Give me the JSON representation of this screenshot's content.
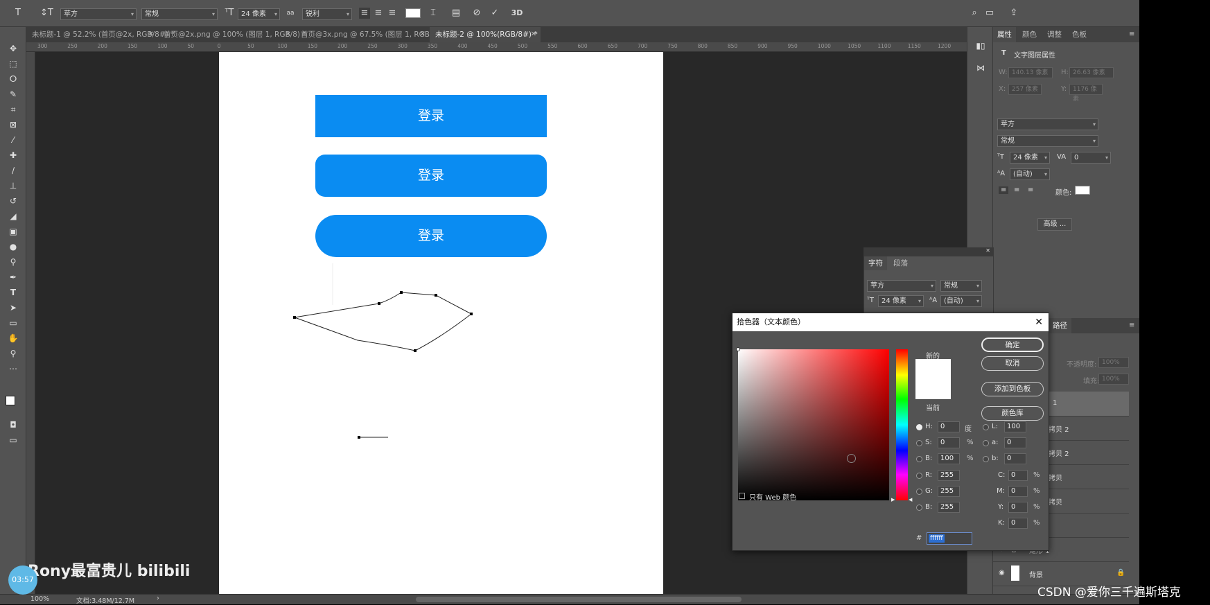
{
  "options_bar": {
    "font_family": "苹方",
    "font_style": "常规",
    "font_size": "24 像素",
    "antialias": "锐利",
    "three_d": "3D",
    "aa_label": "aa"
  },
  "tabs": [
    {
      "label": "未标题-1 @ 52.2% (首页@2x, RGB/8#) *"
    },
    {
      "label": "首页@2x.png @ 100% (图层 1, RGB/8) *"
    },
    {
      "label": "首页@3x.png @ 67.5% (图层 1, RGB/8)"
    },
    {
      "label": "未标题-2 @ 100%(RGB/8#) *"
    }
  ],
  "ruler_ticks": [
    "300",
    "250",
    "200",
    "150",
    "100",
    "50",
    "0",
    "50",
    "100",
    "150",
    "200",
    "250",
    "300",
    "350",
    "400",
    "450",
    "500",
    "550",
    "600",
    "650",
    "700",
    "750",
    "800",
    "850",
    "900",
    "950",
    "1000",
    "1050",
    "1100",
    "1150",
    "1200"
  ],
  "canvas": {
    "buttons": [
      {
        "label": "登录",
        "style": "square"
      },
      {
        "label": "登录",
        "style": "rounded"
      },
      {
        "label": "登录",
        "style": "pill"
      }
    ]
  },
  "properties_panel": {
    "tabs": [
      "属性",
      "颜色",
      "调整",
      "色板"
    ],
    "header": "文字图层属性",
    "w_label": "W:",
    "w_value": "140.13 像素",
    "h_label": "H:",
    "h_value": "26.63 像素",
    "x_label": "X:",
    "x_value": "257 像素",
    "y_label": "Y:",
    "y_value": "1176 像素",
    "font_family": "苹方",
    "font_style": "常规",
    "font_size": "24 像素",
    "tracking": "0",
    "leading": "(自动)",
    "color_label": "颜色:",
    "advanced": "高级 ..."
  },
  "char_panel": {
    "tabs": [
      "字符",
      "段落"
    ],
    "font_family": "苹方",
    "font_style": "常规",
    "font_size": "24 像素",
    "leading": "(自动)"
  },
  "layers_panel": {
    "tab": "路径",
    "opacity_label": "不透明度:",
    "opacity_value": "100%",
    "fill_label": "填充:",
    "fill_value": "100%",
    "layers": [
      "1",
      "拷贝 2",
      "拷贝 2",
      "拷贝",
      "拷贝",
      "",
      "矩形 1",
      "背景"
    ]
  },
  "color_picker": {
    "title": "拾色器（文本颜色）",
    "ok": "确定",
    "cancel": "取消",
    "add_swatch": "添加到色板",
    "color_library": "颜色库",
    "new_label": "新的",
    "current_label": "当前",
    "web_only": "只有 Web 颜色",
    "hsb": [
      {
        "label": "H:",
        "value": "0",
        "unit": "度"
      },
      {
        "label": "S:",
        "value": "0",
        "unit": "%"
      },
      {
        "label": "B:",
        "value": "100",
        "unit": "%"
      }
    ],
    "rgb": [
      {
        "label": "R:",
        "value": "255"
      },
      {
        "label": "G:",
        "value": "255"
      },
      {
        "label": "B:",
        "value": "255"
      }
    ],
    "lab": [
      {
        "label": "L:",
        "value": "100"
      },
      {
        "label": "a:",
        "value": "0"
      },
      {
        "label": "b:",
        "value": "0"
      }
    ],
    "cmyk": [
      {
        "label": "C:",
        "value": "0",
        "unit": "%"
      },
      {
        "label": "M:",
        "value": "0",
        "unit": "%"
      },
      {
        "label": "Y:",
        "value": "0",
        "unit": "%"
      },
      {
        "label": "K:",
        "value": "0",
        "unit": "%"
      }
    ],
    "hex_label": "#",
    "hex": "ffffff"
  },
  "status_bar": {
    "zoom": "100%",
    "doc_info": "文档:3.48M/12.7M"
  },
  "watermarks": {
    "csdn": "CSDN @爱你三千遍斯塔克",
    "bilibili": "Rony最富贵儿 bilibili",
    "timer": "03:57"
  },
  "colors": {
    "button_blue": "#0a8cf2",
    "panel_gray": "#535353",
    "canvas_bg": "#282828"
  }
}
